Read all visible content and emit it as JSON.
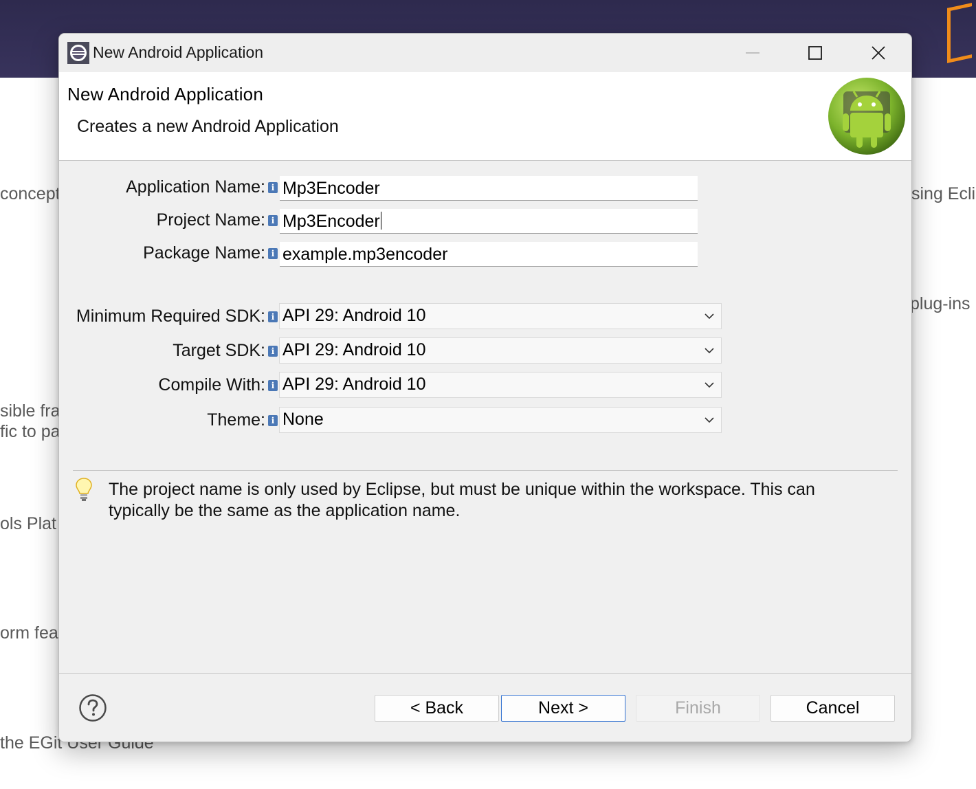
{
  "background": {
    "fragments": [
      "concept",
      "sible fra",
      "fic to pa",
      "ols Plat",
      "orm fea",
      "the EGit User Guide",
      "sing Ecli",
      "plug-ins"
    ]
  },
  "window": {
    "title": "New Android Application",
    "controls": {
      "minimize": "minimize-icon",
      "maximize": "maximize-icon",
      "close": "close-icon"
    }
  },
  "header": {
    "title": "New Android Application",
    "description": "Creates a new Android Application",
    "logo": "android-robot-icon"
  },
  "form": {
    "application_name": {
      "label": "Application Name:",
      "value": "Mp3Encoder"
    },
    "project_name": {
      "label": "Project Name:",
      "value": "Mp3Encoder"
    },
    "package_name": {
      "label": "Package Name:",
      "value": "example.mp3encoder"
    },
    "min_sdk": {
      "label": "Minimum Required SDK:",
      "value": "API 29: Android 10"
    },
    "target_sdk": {
      "label": "Target SDK:",
      "value": "API 29: Android 10"
    },
    "compile_with": {
      "label": "Compile With:",
      "value": "API 29: Android 10"
    },
    "theme": {
      "label": "Theme:",
      "value": "None"
    }
  },
  "hint": {
    "icon": "lightbulb-icon",
    "text": "The project name is only used by Eclipse, but must be unique within the workspace. This can typically be the same as the application name."
  },
  "footer": {
    "back_label": "< Back",
    "next_label": "Next >",
    "finish_label": "Finish",
    "cancel_label": "Cancel",
    "finish_enabled": false
  },
  "colors": {
    "accent": "#2e6fd0",
    "header_bg": "#2e2a4e",
    "info_icon": "#4b78b6",
    "android_green": "#8bc34a"
  }
}
